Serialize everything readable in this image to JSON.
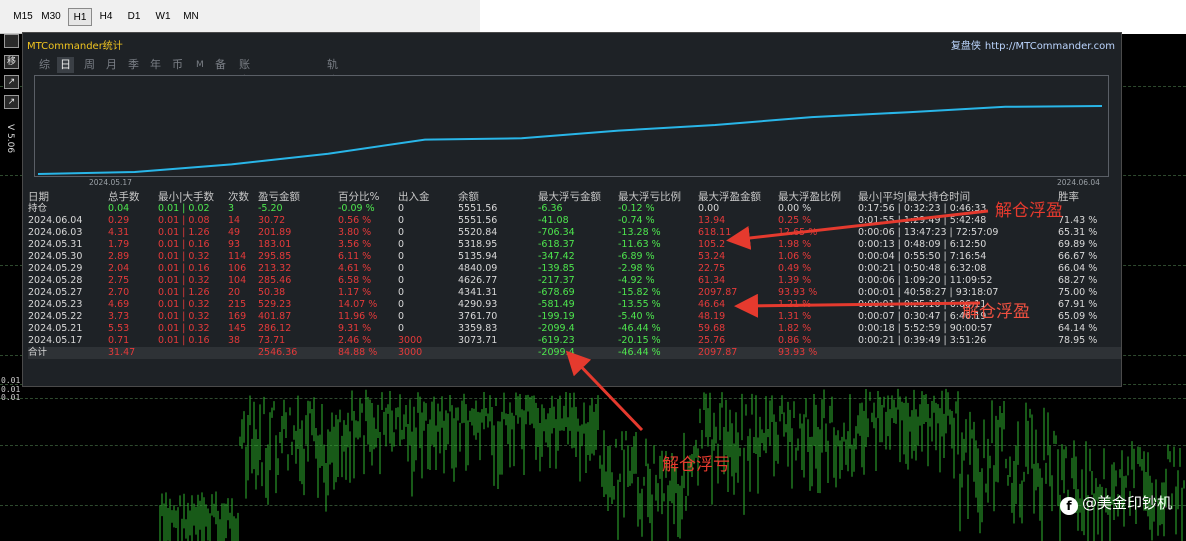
{
  "toolbar": {
    "timeframes": [
      "M15",
      "M30",
      "H1",
      "H4",
      "D1",
      "W1",
      "MN"
    ],
    "active": "H1"
  },
  "chart": {
    "price_labels": [
      "0.01",
      "0.01",
      "0.01"
    ],
    "candle_color": "#2fb32f",
    "side_buttons": [
      "",
      "移",
      "↗",
      "↗",
      "√"
    ],
    "side_label": "V 5.06"
  },
  "panel": {
    "title": "MTCommander统计",
    "brand_cn": "复盘侠",
    "brand_url": "http://MTCommander.com",
    "tabs": [
      "综",
      "日",
      "周",
      "月",
      "季",
      "年",
      "币",
      "M",
      "备",
      "账户",
      "轨迹"
    ],
    "active_tab": "日",
    "eq_start_date": "2024.05.17",
    "eq_end_date": "2024.06.04",
    "line_color": "#29b6e8"
  },
  "table": {
    "headers": [
      "日期",
      "总手数",
      "最小|大手数",
      "次数",
      "盈亏金额",
      "百分比%",
      "出入金",
      "余额",
      "最大浮亏金额",
      "最大浮亏比例",
      "最大浮盈金额",
      "最大浮盈比例",
      "最小|平均|最大持仓时间",
      "胜率"
    ],
    "holding": {
      "label": "持仓",
      "lots": "0.04",
      "minmax": "0.01 | 0.02",
      "count": "3",
      "pnl": "-5.20",
      "pct": "-0.09 %",
      "flow": "0",
      "balance": "5551.56",
      "maxdd": "-6.36",
      "maxdd_pct": "-0.12 %",
      "maxfp": "0.00",
      "maxfp_pct": "0.00 %",
      "times": "0:17:56 | 0:32:23 | 0:46:33",
      "win": ""
    },
    "rows": [
      {
        "date": "2024.06.04",
        "lots": "0.29",
        "minmax": "0.01 | 0.08",
        "count": "14",
        "pnl": "30.72",
        "pct": "0.56 %",
        "flow": "0",
        "balance": "5551.56",
        "maxdd": "-41.08",
        "maxdd_pct": "-0.74 %",
        "maxfp": "13.94",
        "maxfp_pct": "0.25 %",
        "times": "0:01:55 | 1:29:49 | 5:42:48",
        "win": "71.43 %"
      },
      {
        "date": "2024.06.03",
        "lots": "4.31",
        "minmax": "0.01 | 1.26",
        "count": "49",
        "pnl": "201.89",
        "pct": "3.80 %",
        "flow": "0",
        "balance": "5520.84",
        "maxdd": "-706.34",
        "maxdd_pct": "-13.28 %",
        "maxfp": "618.11",
        "maxfp_pct": "12.65 %",
        "times": "0:00:06 | 13:47:23 | 72:57:09",
        "win": "65.31 %"
      },
      {
        "date": "2024.05.31",
        "lots": "1.79",
        "minmax": "0.01 | 0.16",
        "count": "93",
        "pnl": "183.01",
        "pct": "3.56 %",
        "flow": "0",
        "balance": "5318.95",
        "maxdd": "-618.37",
        "maxdd_pct": "-11.63 %",
        "maxfp": "105.2",
        "maxfp_pct": "1.98 %",
        "times": "0:00:13 | 0:48:09 | 6:12:50",
        "win": "69.89 %"
      },
      {
        "date": "2024.05.30",
        "lots": "2.89",
        "minmax": "0.01 | 0.32",
        "count": "114",
        "pnl": "295.85",
        "pct": "6.11 %",
        "flow": "0",
        "balance": "5135.94",
        "maxdd": "-347.42",
        "maxdd_pct": "-6.89 %",
        "maxfp": "53.24",
        "maxfp_pct": "1.06 %",
        "times": "0:00:04 | 0:55:50 | 7:16:54",
        "win": "66.67 %"
      },
      {
        "date": "2024.05.29",
        "lots": "2.04",
        "minmax": "0.01 | 0.16",
        "count": "106",
        "pnl": "213.32",
        "pct": "4.61 %",
        "flow": "0",
        "balance": "4840.09",
        "maxdd": "-139.85",
        "maxdd_pct": "-2.98 %",
        "maxfp": "22.75",
        "maxfp_pct": "0.49 %",
        "times": "0:00:21 | 0:50:48 | 6:32:08",
        "win": "66.04 %"
      },
      {
        "date": "2024.05.28",
        "lots": "2.75",
        "minmax": "0.01 | 0.32",
        "count": "104",
        "pnl": "285.46",
        "pct": "6.58 %",
        "flow": "0",
        "balance": "4626.77",
        "maxdd": "-217.37",
        "maxdd_pct": "-4.92 %",
        "maxfp": "61.34",
        "maxfp_pct": "1.39 %",
        "times": "0:00:06 | 1:09:20 | 11:09:52",
        "win": "68.27 %"
      },
      {
        "date": "2024.05.27",
        "lots": "2.70",
        "minmax": "0.01 | 1.26",
        "count": "20",
        "pnl": "50.38",
        "pct": "1.17 %",
        "flow": "0",
        "balance": "4341.31",
        "maxdd": "-678.69",
        "maxdd_pct": "-15.82 %",
        "maxfp": "2097.87",
        "maxfp_pct": "93.93 %",
        "times": "0:00:01 | 40:58:27 | 93:18:07",
        "win": "75.00 %"
      },
      {
        "date": "2024.05.23",
        "lots": "4.69",
        "minmax": "0.01 | 0.32",
        "count": "215",
        "pnl": "529.23",
        "pct": "14.07 %",
        "flow": "0",
        "balance": "4290.93",
        "maxdd": "-581.49",
        "maxdd_pct": "-13.55 %",
        "maxfp": "46.64",
        "maxfp_pct": "1.21 %",
        "times": "0:00:01 | 0:25:10 | 6:06:11",
        "win": "67.91 %"
      },
      {
        "date": "2024.05.22",
        "lots": "3.73",
        "minmax": "0.01 | 0.32",
        "count": "169",
        "pnl": "401.87",
        "pct": "11.96 %",
        "flow": "0",
        "balance": "3761.70",
        "maxdd": "-199.19",
        "maxdd_pct": "-5.40 %",
        "maxfp": "48.19",
        "maxfp_pct": "1.31 %",
        "times": "0:00:07 | 0:30:47 | 6:46:19",
        "win": "65.09 %"
      },
      {
        "date": "2024.05.21",
        "lots": "5.53",
        "minmax": "0.01 | 0.32",
        "count": "145",
        "pnl": "286.12",
        "pct": "9.31 %",
        "flow": "0",
        "balance": "3359.83",
        "maxdd": "-2099.4",
        "maxdd_pct": "-46.44 %",
        "maxfp": "59.68",
        "maxfp_pct": "1.82 %",
        "times": "0:00:18 | 5:52:59 | 90:00:57",
        "win": "64.14 %"
      },
      {
        "date": "2024.05.17",
        "lots": "0.71",
        "minmax": "0.01 | 0.16",
        "count": "38",
        "pnl": "73.71",
        "pct": "2.46 %",
        "flow": "3000",
        "balance": "3073.71",
        "maxdd": "-619.23",
        "maxdd_pct": "-20.15 %",
        "maxfp": "25.76",
        "maxfp_pct": "0.86 %",
        "times": "0:00:21 | 0:39:49 | 3:51:26",
        "win": "78.95 %"
      }
    ],
    "total": {
      "label": "合计",
      "lots": "31.47",
      "pnl": "2546.36",
      "pct": "84.88 %",
      "flow": "3000",
      "maxdd": "-2099.4",
      "maxdd_pct": "-46.44 %",
      "maxfp": "2097.87",
      "maxfp_pct": "93.93 %"
    }
  },
  "annotations": {
    "close_float_profit_1": "解仓浮盈",
    "close_float_profit_2": "解仓浮盈",
    "close_float_loss": "解仓浮亏",
    "arrow_color": "#e53a2e"
  },
  "watermark": {
    "logo": "f",
    "text": "@美金印钞机"
  }
}
